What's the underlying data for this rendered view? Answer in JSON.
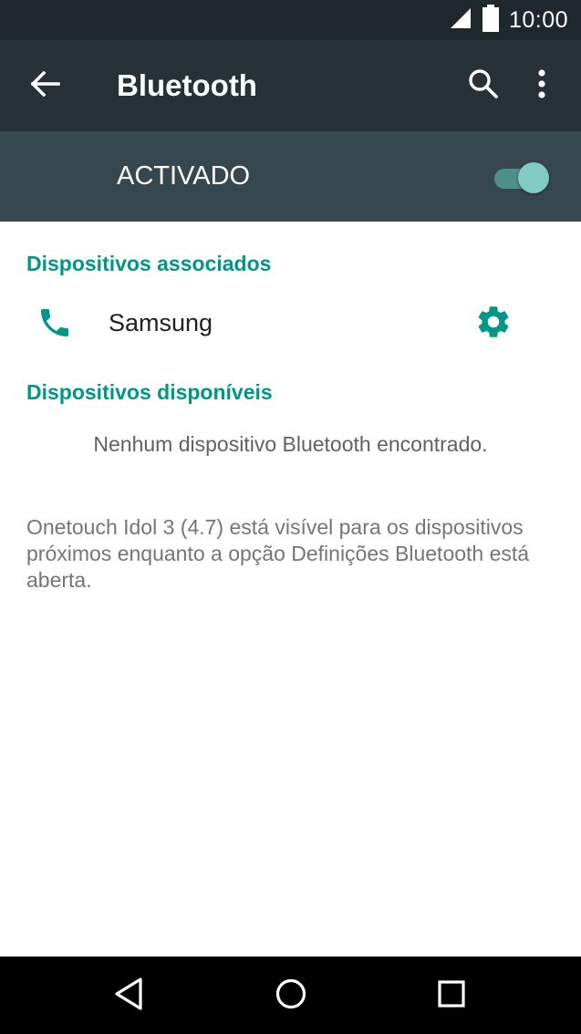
{
  "status_bar": {
    "time": "10:00",
    "icons": [
      "signal-icon",
      "battery-icon"
    ]
  },
  "toolbar": {
    "title": "Bluetooth",
    "icons": [
      "back-arrow-icon",
      "search-icon",
      "more-vert-icon"
    ]
  },
  "bluetooth_switch": {
    "label": "ACTIVADO",
    "state": "on"
  },
  "paired_section": {
    "header": "Dispositivos associados",
    "devices": [
      {
        "name": "Samsung",
        "icon": "phone-icon",
        "action_icon": "gear-icon"
      }
    ]
  },
  "available_section": {
    "header": "Dispositivos disponíveis",
    "empty_message": "Nenhum dispositivo Bluetooth encontrado."
  },
  "visibility_message": "Onetouch Idol 3 (4.7) está visível para os dispositivos próximos enquanto a opção Definições Bluetooth está aberta.",
  "nav_bar": {
    "icons": [
      "back-triangle-icon",
      "home-circle-icon",
      "recents-square-icon"
    ]
  },
  "colors": {
    "accent": "#009688",
    "toolbar": "#263238",
    "switch_bar": "#37474f",
    "status_bar": "#1f282d",
    "toggle_thumb": "#80cbc4"
  }
}
